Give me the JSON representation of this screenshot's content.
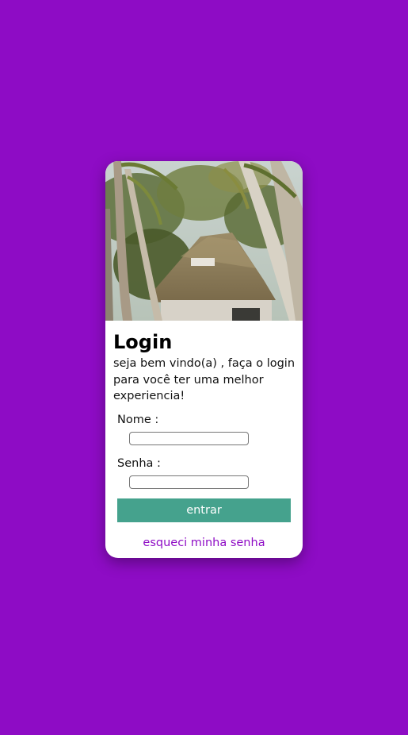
{
  "page": {
    "background_color": "#8e0cc5"
  },
  "card": {
    "hero_image": "palm-trees-thatched-hut-photo",
    "title": "Login",
    "subtitle": "seja bem vindo(a) , faça o login para você ter uma melhor experiencia!",
    "name_label": "Nome :",
    "name_value": "",
    "password_label": "Senha :",
    "password_value": "",
    "submit_label": "entrar",
    "forgot_link": "esqueci minha senha",
    "accent_color": "#45a28d",
    "link_color": "#8e0cc5"
  }
}
